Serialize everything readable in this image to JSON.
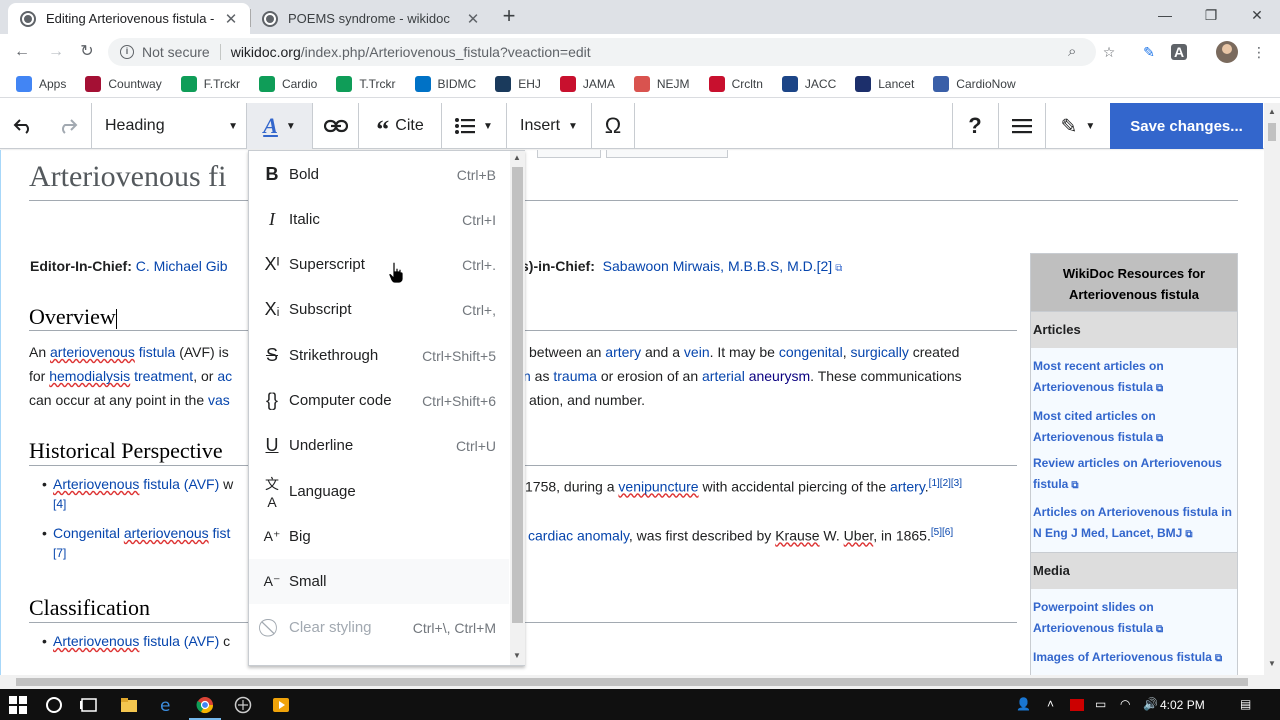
{
  "browser": {
    "tabs": [
      {
        "title": "Editing Arteriovenous fistula - wikidoc",
        "close": "✕"
      },
      {
        "title": "POEMS syndrome - wikidoc",
        "close": "✕"
      }
    ],
    "new_tab": "+",
    "window_controls": {
      "minimize": "—",
      "restore": "❐",
      "close": "✕"
    },
    "security_label": "Not secure",
    "url_host": "wikidoc.org",
    "url_path": "/index.php/Arteriovenous_fistula?veaction=edit"
  },
  "bookmarks": [
    {
      "label": "Apps",
      "color": "#4285f4"
    },
    {
      "label": "Countway",
      "color": "#a41034"
    },
    {
      "label": "F.Trckr",
      "color": "#0f9d58"
    },
    {
      "label": "Cardio",
      "color": "#0f9d58"
    },
    {
      "label": "T.Trckr",
      "color": "#0f9d58"
    },
    {
      "label": "BIDMC",
      "color": "#0072c6"
    },
    {
      "label": "EHJ",
      "color": "#1a3a5c"
    },
    {
      "label": "JAMA",
      "color": "#c8102e"
    },
    {
      "label": "NEJM",
      "color": "#d9534f"
    },
    {
      "label": "Crcltn",
      "color": "#c8102e"
    },
    {
      "label": "JACC",
      "color": "#1c4587"
    },
    {
      "label": "Lancet",
      "color": "#1c2f6b"
    },
    {
      "label": "CardioNow",
      "color": "#3a5fa8"
    }
  ],
  "ve_toolbar": {
    "format_label": "Heading",
    "cite_label": "Cite",
    "insert_label": "Insert",
    "help": "?",
    "save_label": "Save changes..."
  },
  "style_menu": [
    {
      "icon": "B",
      "label": "Bold",
      "shortcut": "Ctrl+B"
    },
    {
      "icon": "I",
      "label": "Italic",
      "shortcut": "Ctrl+I"
    },
    {
      "icon": "Xᴵ",
      "label": "Superscript",
      "shortcut": "Ctrl+."
    },
    {
      "icon": "Xᵢ",
      "label": "Subscript",
      "shortcut": "Ctrl+,"
    },
    {
      "icon": "S",
      "label": "Strikethrough",
      "shortcut": "Ctrl+Shift+5"
    },
    {
      "icon": "{}",
      "label": "Computer code",
      "shortcut": "Ctrl+Shift+6"
    },
    {
      "icon": "U",
      "label": "Underline",
      "shortcut": "Ctrl+U"
    },
    {
      "icon": "文A",
      "label": "Language",
      "shortcut": ""
    },
    {
      "icon": "A⁺",
      "label": "Big",
      "shortcut": ""
    },
    {
      "icon": "A⁻",
      "label": "Small",
      "shortcut": ""
    },
    {
      "icon": "⃠",
      "label": "Clear styling",
      "shortcut": "Ctrl+\\, Ctrl+M"
    }
  ],
  "article": {
    "title": "Arteriovenous fi",
    "editor_line": {
      "label": "Editor-In-Chief:",
      "name": "C. Michael Gib",
      "assoc_label": "s)-in-Chief:",
      "assoc_name": "Sabawoon Mirwais, M.B.B.S, M.D.",
      "ref": "[2]"
    },
    "overview": {
      "heading": "Overview",
      "l1a": "An ",
      "l1b": "arteriovenous",
      "l1c": " ",
      "l1d": "fistula",
      "l1e": " (AVF) is",
      "l1r1": " between an ",
      "l1r2": "artery",
      "l1r3": " and a ",
      "l1r4": "vein",
      "l1r5": ". It may be ",
      "l1r6": "congenital",
      "l1r7": ", ",
      "l1r8": "surgically",
      "l1r9": " created",
      "l2a": "for ",
      "l2b": "hemodialysis",
      "l2c": " ",
      "l2d": "treatment",
      "l2e": ", or ",
      "l2f": "ac",
      "l2r1": "n",
      "l2r2": " as ",
      "l2r3": "trauma",
      "l2r4": " or erosion of an ",
      "l2r5": "arterial",
      "l2r6": " ",
      "l2r7": "aneurysm",
      "l2r8": ". These communications",
      "l3a": "can occur at any point in the ",
      "l3b": "vas",
      "l3r": "ation, and number."
    },
    "history": {
      "heading": "Historical Perspective",
      "b1a": "Arteriovenous",
      "b1b": " fistula (AVF)",
      "b1c": " w",
      "b1r1": "1758, during a ",
      "b1r2": "venipuncture",
      "b1r3": " with accidental piercing of the ",
      "b1r4": "artery",
      "b1r5": ".",
      "b1sup": "[1][2][3]",
      "b1sup2": "[4]",
      "b2a": "Congenital ",
      "b2b": "arteriovenous",
      "b2c": " fist",
      "b2r1": "cardiac anomaly",
      "b2r2": ", was first described by ",
      "b2r3": "Krause",
      "b2r4": " W. ",
      "b2r5": "Uber",
      "b2r6": ", in  1865.",
      "b2sup": "[5][6]",
      "b2sup2": "[7]"
    },
    "classification": {
      "heading": "Classification",
      "b1a": "Arteriovenous",
      "b1b": " fistula (AVF)",
      "b1c": " c"
    }
  },
  "infobox": {
    "title": "WikiDoc Resources for Arteriovenous fistula",
    "sections": [
      {
        "name": "Articles",
        "items": [
          "Most recent articles on Arteriovenous fistula",
          "Most cited articles on Arteriovenous fistula",
          "Review articles on Arteriovenous fistula",
          "Articles on Arteriovenous fistula in N Eng J Med, Lancet, BMJ"
        ]
      },
      {
        "name": "Media",
        "items": [
          "Powerpoint slides on Arteriovenous fistula",
          "Images of Arteriovenous fistula"
        ]
      }
    ]
  },
  "taskbar": {
    "clock": "4:02 PM"
  }
}
